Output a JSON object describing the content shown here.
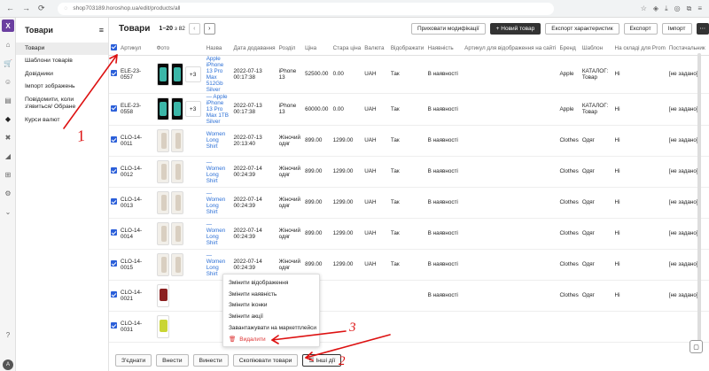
{
  "browser": {
    "url": "shop703189.horoshop.ua/edit/products/all"
  },
  "rail": {
    "logo": "Х",
    "avatar": "A"
  },
  "sidebar": {
    "title": "Товари",
    "items": [
      "Товари",
      "Шаблони товарів",
      "Довідники",
      "Імпорт зображень",
      "Повідомити, коли з'явиться/ Обране",
      "Курси валют"
    ]
  },
  "topbar": {
    "title": "Товари",
    "pagination_range": "1–20",
    "pagination_of": "з 82",
    "hide_mod": "Приховати модифікації",
    "new_product": "+ Новий товар",
    "export_chars": "Експорт характеристик",
    "export": "Експорт",
    "import": "Імпорт"
  },
  "table": {
    "headers": [
      "Артикул",
      "Фото",
      "Назва",
      "Дата додавання",
      "Розділ",
      "Ціна",
      "Стара ціна",
      "Валюта",
      "Відображати",
      "Наявність",
      "Артикул для відображення на сайті",
      "Бренд",
      "Шаблон",
      "На складі для Prom",
      "Постачальник"
    ],
    "rows": [
      {
        "sku": "ELE-23-0557",
        "img": "ph",
        "extra": "+3",
        "name": "Apple iPhone 13 Pro Max 512Gb Silver",
        "date": "2022-07-13 00:17:38",
        "section": "iPhone 13",
        "price": "52500.00",
        "old": "0.00",
        "cur": "UAH",
        "show": "Так",
        "avail": "В наявності",
        "brand": "Apple",
        "tpl": "КАТАЛОГ: Товар",
        "prom": "Ні",
        "sup": "[не задано]"
      },
      {
        "sku": "ELE-23-0558",
        "img": "ph",
        "extra": "+3",
        "name": "— Apple iPhone 13 Pro Max 1TB Silver",
        "date": "2022-07-13 00:17:38",
        "section": "iPhone 13",
        "price": "60000.00",
        "old": "0.00",
        "cur": "UAH",
        "show": "Так",
        "avail": "В наявності",
        "brand": "Apple",
        "tpl": "КАТАЛОГ: Товар",
        "prom": "Ні",
        "sup": "[не задано]"
      },
      {
        "sku": "CLO-14-0011",
        "img": "cl",
        "extra": "",
        "name": "Women Long Shirt",
        "date": "2022-07-13 20:13:40",
        "section": "Жіночий одяг",
        "price": "899.00",
        "old": "1299.00",
        "cur": "UAH",
        "show": "Так",
        "avail": "В наявності",
        "brand": "Clothes",
        "tpl": "Одяг",
        "prom": "Ні",
        "sup": "[не задано]"
      },
      {
        "sku": "CLO-14-0012",
        "img": "cl",
        "extra": "",
        "name": "— Women Long Shirt",
        "date": "2022-07-14 00:24:39",
        "section": "Жіночий одяг",
        "price": "899.00",
        "old": "1299.00",
        "cur": "UAH",
        "show": "Так",
        "avail": "В наявності",
        "brand": "Clothes",
        "tpl": "Одяг",
        "prom": "Ні",
        "sup": "[не задано]"
      },
      {
        "sku": "CLO-14-0013",
        "img": "cl",
        "extra": "",
        "name": "— Women Long Shirt",
        "date": "2022-07-14 00:24:39",
        "section": "Жіночий одяг",
        "price": "899.00",
        "old": "1299.00",
        "cur": "UAH",
        "show": "Так",
        "avail": "В наявності",
        "brand": "Clothes",
        "tpl": "Одяг",
        "prom": "Ні",
        "sup": "[не задано]"
      },
      {
        "sku": "CLO-14-0014",
        "img": "cl",
        "extra": "",
        "name": "— Women Long Shirt",
        "date": "2022-07-14 00:24:39",
        "section": "Жіночий одяг",
        "price": "899.00",
        "old": "1299.00",
        "cur": "UAH",
        "show": "Так",
        "avail": "В наявності",
        "brand": "Clothes",
        "tpl": "Одяг",
        "prom": "Ні",
        "sup": "[не задано]"
      },
      {
        "sku": "CLO-14-0015",
        "img": "cl",
        "extra": "",
        "name": "— Women Long Shirt",
        "date": "2022-07-14 00:24:39",
        "section": "Жіночий одяг",
        "price": "899.00",
        "old": "1299.00",
        "cur": "UAH",
        "show": "Так",
        "avail": "В наявності",
        "brand": "Clothes",
        "tpl": "Одяг",
        "prom": "Ні",
        "sup": "[не задано]"
      },
      {
        "sku": "CLO-14-0021",
        "img": "rd",
        "extra": "",
        "name": "",
        "date": "",
        "section": "",
        "price": "",
        "old": "",
        "cur": "",
        "show": "",
        "avail": "В наявності",
        "brand": "Clothes",
        "tpl": "Одяг",
        "prom": "Ні",
        "sup": "[не задано]"
      },
      {
        "sku": "CLO-14-0031",
        "img": "yl",
        "extra": "",
        "name": "",
        "date": "",
        "section": "",
        "price": "",
        "old": "",
        "cur": "",
        "show": "",
        "avail": "",
        "brand": "",
        "tpl": "",
        "prom": "",
        "sup": ""
      }
    ]
  },
  "bottom": {
    "btns": [
      "З'єднати",
      "Внести",
      "Винести",
      "Скопіювати товари",
      "☰ Інші дії"
    ]
  },
  "menu": {
    "items": [
      "Змінити відображення",
      "Змінити наявність",
      "Змінити іконки",
      "Змінити акції",
      "Завантажувати на маркетплейси",
      "Видалити"
    ]
  },
  "annotations": [
    "1",
    "2",
    "3"
  ],
  "colors": {
    "checkbox": "#2b5fd9",
    "link": "#2b6fd6",
    "annotation": "#d11"
  }
}
